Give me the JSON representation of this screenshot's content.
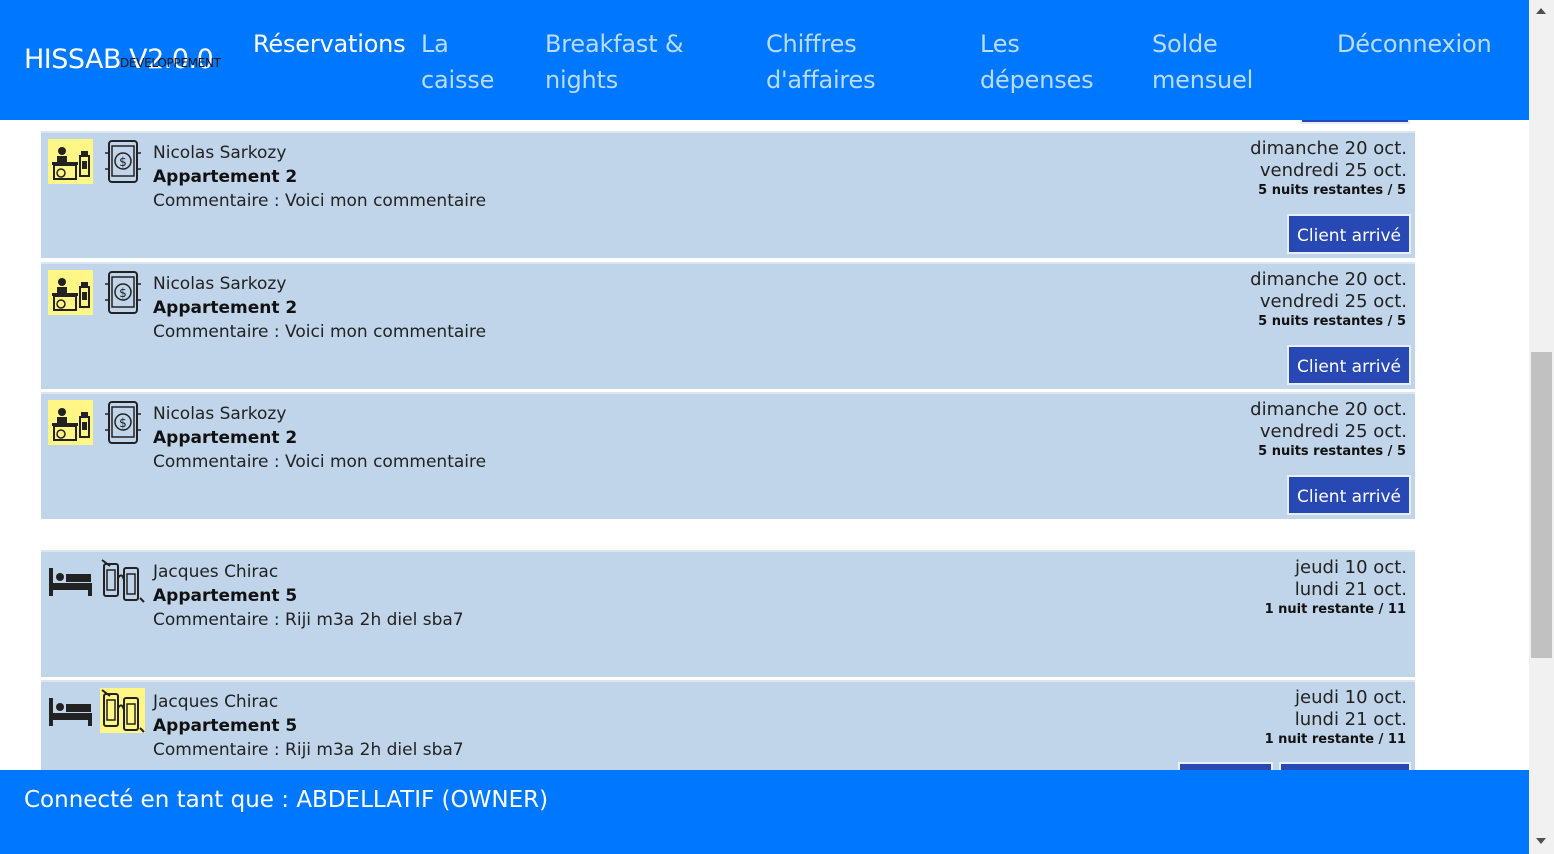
{
  "header": {
    "brand": "HISSAB V2.0.0",
    "brand_sub": "DEVELOPPEMENT",
    "nav": [
      {
        "label": "Réservations"
      },
      {
        "label": "La caisse"
      },
      {
        "label": "Breakfast & nights"
      },
      {
        "label": "Chiffres d'affaires"
      },
      {
        "label": "Les dépenses"
      },
      {
        "label": "Solde mensuel"
      },
      {
        "label": "Déconnexion"
      }
    ]
  },
  "reservations": [
    {
      "name": "Nicolas Sarkozy",
      "apartment": "Appartement 2",
      "comment": "Commentaire : Voici mon commentaire",
      "date_start": "dimanche 20 oct.",
      "date_end": "vendredi 25 oct.",
      "nights": "5 nuits restantes / 5",
      "button": "Client arrivé",
      "icon1": "reception-desk-icon",
      "icon2": "mobile-payment-icon"
    },
    {
      "name": "Nicolas Sarkozy",
      "apartment": "Appartement 2",
      "comment": "Commentaire : Voici mon commentaire",
      "date_start": "dimanche 20 oct.",
      "date_end": "vendredi 25 oct.",
      "nights": "5 nuits restantes / 5",
      "button": "Client arrivé",
      "icon1": "reception-desk-icon",
      "icon2": "mobile-payment-icon"
    },
    {
      "name": "Nicolas Sarkozy",
      "apartment": "Appartement 2",
      "comment": "Commentaire : Voici mon commentaire",
      "date_start": "dimanche 20 oct.",
      "date_end": "vendredi 25 oct.",
      "nights": "5 nuits restantes / 5",
      "button": "Client arrivé",
      "icon1": "reception-desk-icon",
      "icon2": "mobile-payment-icon"
    },
    {
      "name": "Jacques Chirac",
      "apartment": "Appartement 5",
      "comment": "Commentaire : Riji m3a 2h diel sba7",
      "date_start": "jeudi 10 oct.",
      "date_end": "lundi 21 oct.",
      "nights": "1 nuit restante / 11",
      "icon1": "bed-icon",
      "icon2": "cash-payment-icon"
    },
    {
      "name": "Jacques Chirac",
      "apartment": "Appartement 5",
      "comment": "Commentaire : Riji m3a 2h diel sba7",
      "date_start": "jeudi 10 oct.",
      "date_end": "lundi 21 oct.",
      "nights": "1 nuit restante / 11",
      "icon1": "bed-icon",
      "icon2": "cash-payment-icon"
    }
  ],
  "footer": {
    "text": "Connecté en tant que : ABDELLATIF (OWNER)"
  },
  "colors": {
    "header_bg": "#0077ff",
    "card_bg": "#c0d5e9",
    "button_bg": "#2849b3",
    "icon_highlight": "#fff685"
  }
}
